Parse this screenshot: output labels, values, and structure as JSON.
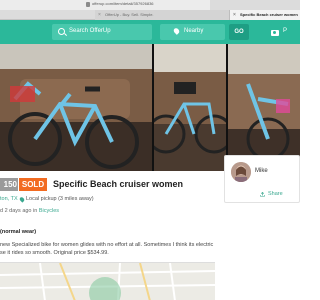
{
  "browser": {
    "url": "offerup.com/item/detail/357926836",
    "tabs": [
      {
        "label": "OfferUp - Buy. Sell. Simple.",
        "active": false
      },
      {
        "label": "Specific Beach cruiser women",
        "active": true
      }
    ]
  },
  "header": {
    "search_placeholder": "Search OfferUp",
    "location_placeholder": "Nearby",
    "go_label": "GO",
    "post_label": "P",
    "accent_color": "#2bb89a"
  },
  "listing": {
    "price": "150",
    "sold_label": "SOLD",
    "title": "Specific Beach cruiser women",
    "location": "ton, TX",
    "pickup": "Local pickup (3 miles away)",
    "posted_prefix": "d 2 days ago in ",
    "category": "Bicycles",
    "condition": "(normal wear)",
    "description_line1": "new Specialized bike for women glides with no effort at all. Sometimes I think its electric",
    "description_line2": "se it rides so smooth. Original price $534.99.",
    "status_color": "#f26b21"
  },
  "seller": {
    "name": "Mike",
    "share_label": "Share"
  }
}
